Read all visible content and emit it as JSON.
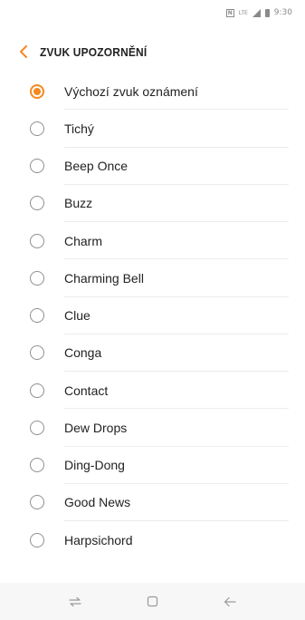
{
  "status_bar": {
    "nfc": "N",
    "network": "LTE",
    "time": "9:30"
  },
  "header": {
    "title": "ZVUK UPOZORNĚNÍ",
    "back_icon": "chevron-left-icon"
  },
  "colors": {
    "accent": "#f5891f",
    "text": "#222222",
    "radio_border": "#8f8f8f"
  },
  "sounds": [
    {
      "label": "Výchozí zvuk oznámení",
      "selected": true
    },
    {
      "label": "Tichý",
      "selected": false
    },
    {
      "label": "Beep Once",
      "selected": false
    },
    {
      "label": "Buzz",
      "selected": false
    },
    {
      "label": "Charm",
      "selected": false
    },
    {
      "label": "Charming Bell",
      "selected": false
    },
    {
      "label": "Clue",
      "selected": false
    },
    {
      "label": "Conga",
      "selected": false
    },
    {
      "label": "Contact",
      "selected": false
    },
    {
      "label": "Dew Drops",
      "selected": false
    },
    {
      "label": "Ding-Dong",
      "selected": false
    },
    {
      "label": "Good News",
      "selected": false
    },
    {
      "label": "Harpsichord",
      "selected": false
    }
  ],
  "nav_bar": {
    "recents_icon": "recents-icon",
    "home_icon": "home-icon",
    "back_icon": "back-arrow-icon"
  }
}
